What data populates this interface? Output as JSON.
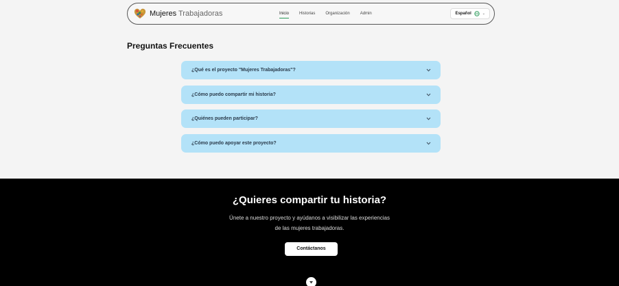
{
  "brand": {
    "name_1": "Mujeres",
    "name_2": "Trabajadoras",
    "logo_icon": "heart-logo-icon"
  },
  "nav": {
    "items": [
      {
        "label": "Inicio",
        "active": true
      },
      {
        "label": "Historias",
        "active": false
      },
      {
        "label": "Organización",
        "active": false
      },
      {
        "label": "Admin",
        "active": false
      }
    ],
    "language": "Español",
    "language_icon": "globe-icon"
  },
  "faq": {
    "title": "Preguntas Frecuentes",
    "items": [
      {
        "question": "¿Qué es el proyecto \"Mujeres Trabajadoras\"?"
      },
      {
        "question": "¿Cómo puedo compartir mi historia?"
      },
      {
        "question": "¿Quiénes pueden participar?"
      },
      {
        "question": "¿Cómo puedo apoyar este proyecto?"
      }
    ]
  },
  "cta": {
    "title": "¿Quieres compartir tu historia?",
    "text_line1": "Únete a nuestro proyecto y ayúdanos a visibilizar las experiencias",
    "text_line2": "de las mujeres trabajadoras.",
    "button": "Contáctanos"
  },
  "colors": {
    "accent": "#2a9a5a",
    "faq_bg": "#b3e2f8",
    "cta_bg": "#000000"
  }
}
